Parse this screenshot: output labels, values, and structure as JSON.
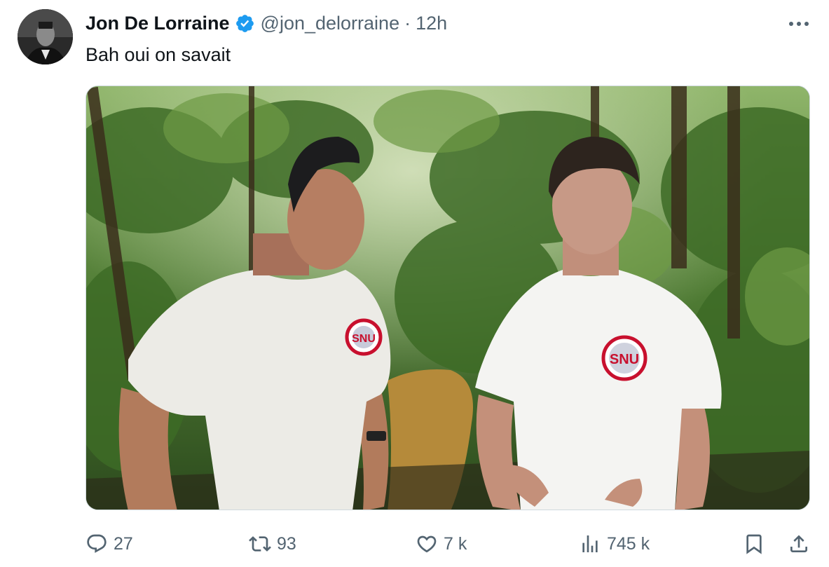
{
  "tweet": {
    "author_name": "Jon De Lorraine",
    "handle": "@jon_delorraine",
    "separator": "·",
    "time": "12h",
    "text": "Bah oui on savait",
    "media": {
      "shirt_logo_text": "SNU"
    }
  },
  "actions": {
    "replies": "27",
    "reposts": "93",
    "likes": "7 k",
    "views": "745 k"
  },
  "colors": {
    "verified_blue": "#1d9bf0",
    "secondary_text": "#536471",
    "primary_text": "#0f1419"
  }
}
